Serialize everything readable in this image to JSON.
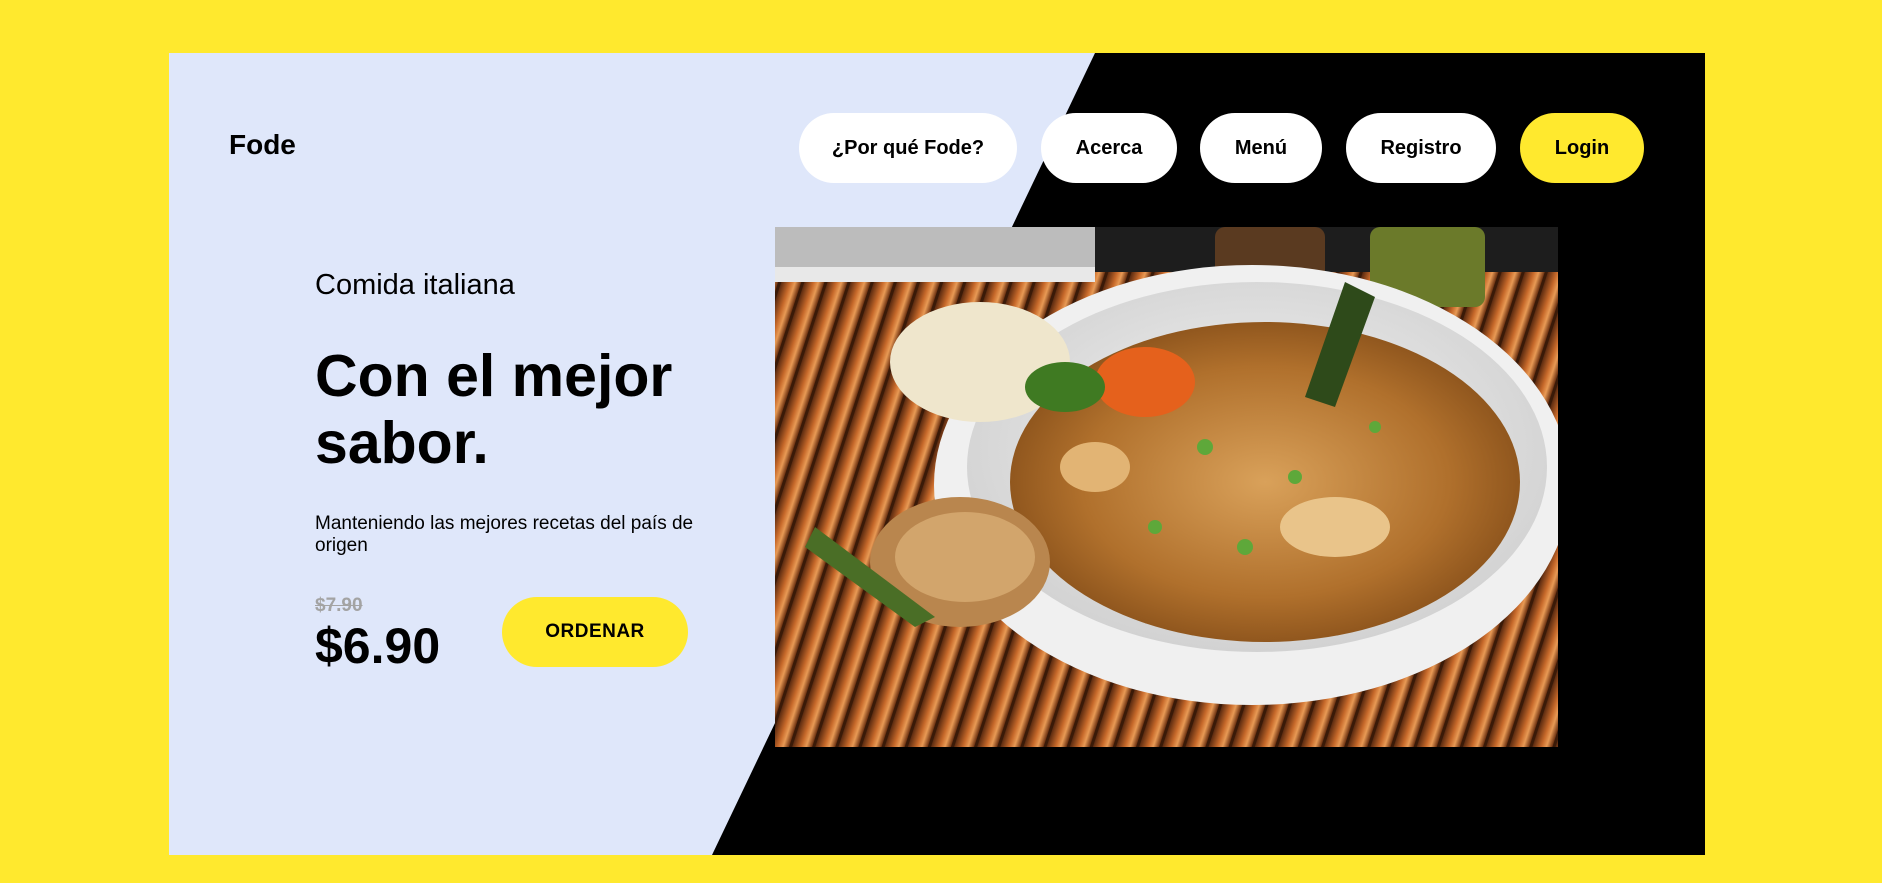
{
  "brand": "Fode",
  "nav": {
    "why": "¿Por qué Fode?",
    "about": "Acerca",
    "menu": "Menú",
    "register": "Registro",
    "login": "Login"
  },
  "hero": {
    "eyebrow": "Comida italiana",
    "headline": "Con el mejor sabor.",
    "description": "Manteniendo las mejores recetas del país de origen",
    "old_price": "$7.90",
    "price": "$6.90",
    "cta": "ORDENAR"
  },
  "colors": {
    "accent": "#FFE92E",
    "panel": "#DFE7FA",
    "dark": "#000000"
  },
  "image": {
    "subject": "noodle-dish-photo"
  }
}
